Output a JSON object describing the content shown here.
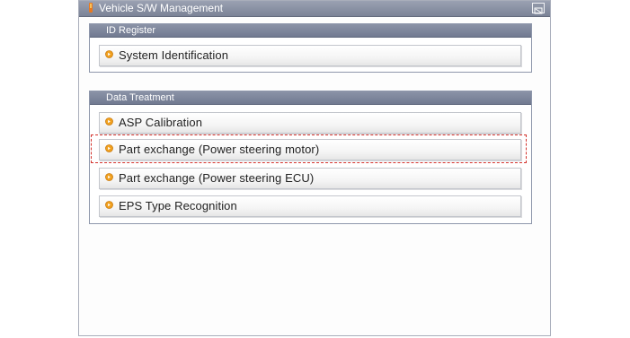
{
  "window": {
    "title": "Vehicle S/W Management",
    "icon": "app-icon",
    "close_icon": "window-control-icon"
  },
  "id_register": {
    "header": "ID Register",
    "items": [
      {
        "label": "System Identification"
      }
    ]
  },
  "data_treatment": {
    "header": "Data Treatment",
    "items": [
      {
        "label": "ASP Calibration"
      },
      {
        "label": "Part exchange (Power steering motor)"
      },
      {
        "label": "Part exchange (Power steering ECU)"
      },
      {
        "label": "EPS Type Recognition"
      }
    ]
  },
  "colors": {
    "accent_bullet": "#f0a01e",
    "highlight_border": "#d3322c",
    "header_bg": "#7b8397"
  },
  "selected_item": "Part exchange (Power steering motor)"
}
